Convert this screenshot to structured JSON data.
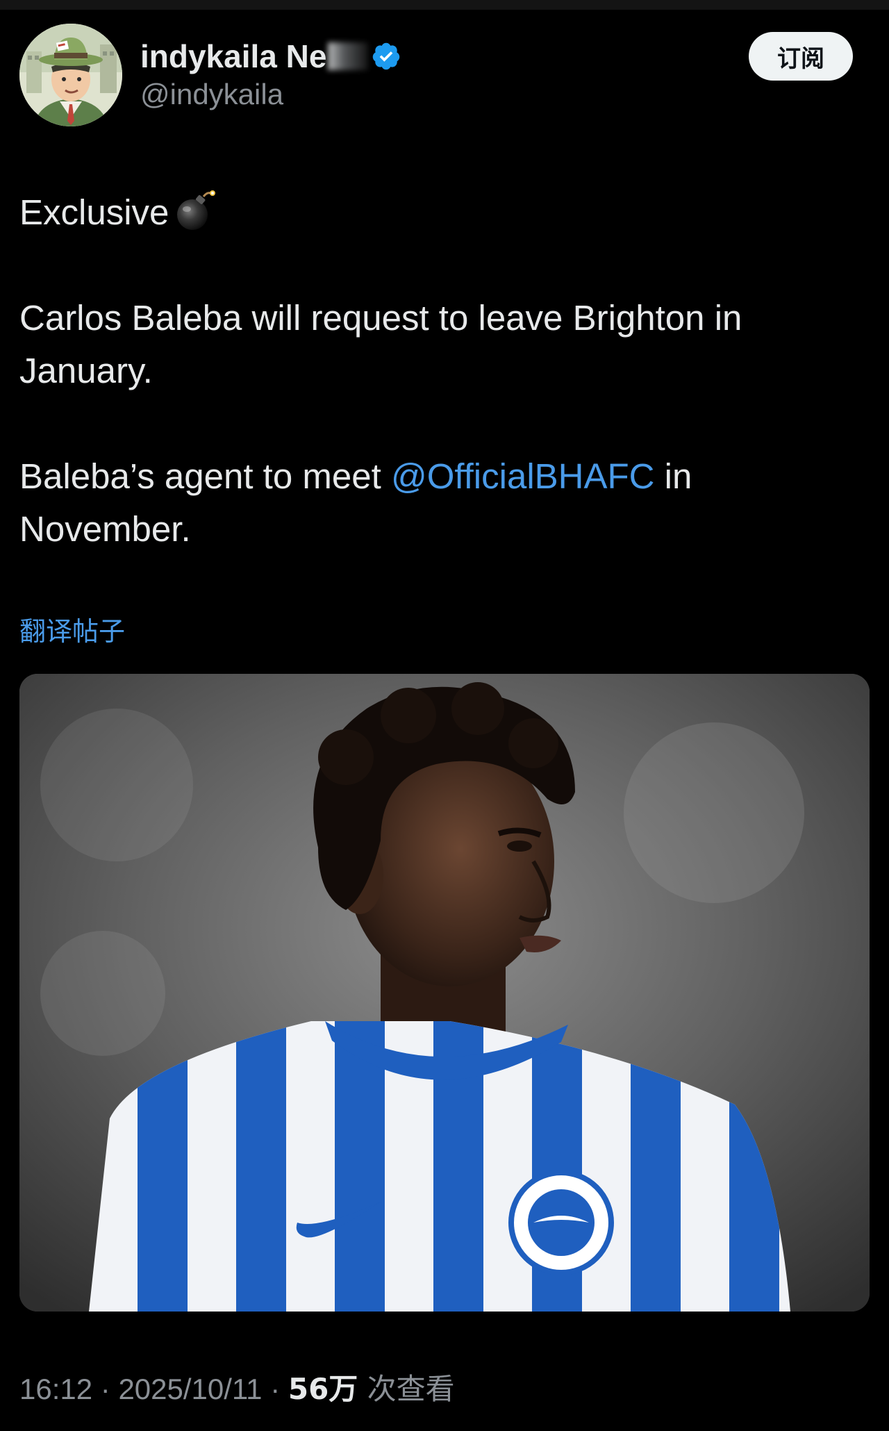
{
  "author": {
    "display_name": "indykaila Ne",
    "handle": "@indykaila",
    "verified": true,
    "avatar_icon": "cartoon-man-avatar-icon"
  },
  "subscribe_button": {
    "label": "订阅"
  },
  "tweet": {
    "line1": "Exclusive",
    "line1_emoji": "bomb-icon",
    "paragraph2": "Carlos Baleba will request to leave Brighton in January.",
    "paragraph3_before": "Baleba’s agent to meet ",
    "paragraph3_mention": "@OfficialBHAFC",
    "paragraph3_after": " in November."
  },
  "translate_link": "翻译帖子",
  "media": {
    "description_icon": "player-photo-icon"
  },
  "meta": {
    "time": "16:12",
    "sep1": " · ",
    "date": "2025/10/11",
    "sep2": " · ",
    "views_count": "56万",
    "views_label": " 次查看"
  },
  "colors": {
    "background": "#000000",
    "text": "#e7e9ea",
    "muted": "#8b9096",
    "link": "#4a9be9",
    "verified": "#1d9bf0"
  }
}
